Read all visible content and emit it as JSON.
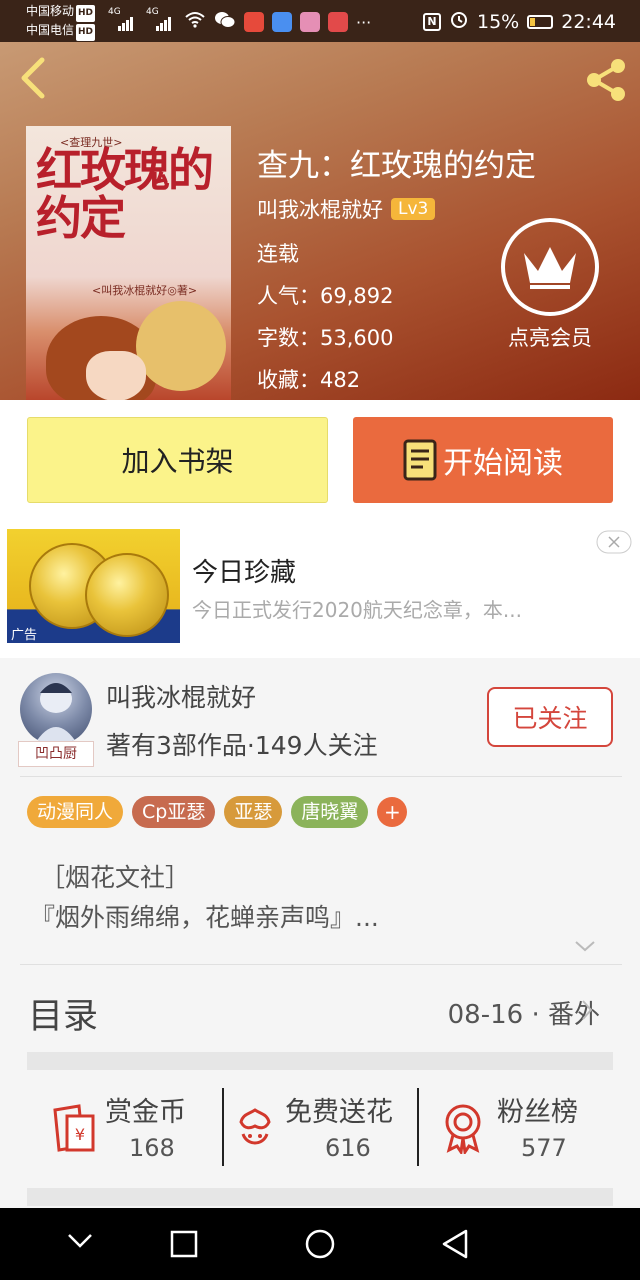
{
  "status_bar": {
    "carrier1": "中国移动",
    "carrier2": "中国电信",
    "hd": "HD",
    "net": "4G",
    "more": "···",
    "nfc": "N",
    "battery": "15%",
    "time": "22:44"
  },
  "book": {
    "cover_series": "<查理九世>",
    "cover_title": "红玫瑰的约定",
    "cover_author": "<叫我冰棍就好◎著>",
    "title": "查九：红玫瑰的约定",
    "author": "叫我冰棍就好",
    "level": "Lv3",
    "status": "连载",
    "popularity": "人气：69,892",
    "words": "字数：53,600",
    "favorites": "收藏：482",
    "vip_label": "点亮会员"
  },
  "actions": {
    "add_shelf": "加入书架",
    "start_read": "开始阅读"
  },
  "ad": {
    "tag": "广告",
    "title": "今日珍藏",
    "description": "今日正式发行2020航天纪念章，本..."
  },
  "author_card": {
    "name": "叫我冰棍就好",
    "badge": "凹凸厨",
    "stats": "著有3部作品·149人关注",
    "follow_label": "已关注",
    "tags": [
      {
        "label": "动漫同人",
        "color": "#f0a93a"
      },
      {
        "label": "Cp亚瑟",
        "color": "#c76b4f"
      },
      {
        "label": "亚瑟",
        "color": "#d79a3b"
      },
      {
        "label": "唐晓翼",
        "color": "#8bb35a"
      }
    ],
    "add_tag": "+",
    "intro_line1": "［烟花文社］",
    "intro_line2": "『烟外雨绵绵，花蝉亲声鸣』..."
  },
  "toc": {
    "label": "目录",
    "latest": "08-16 · 番外"
  },
  "stats": [
    {
      "label": "赏金币",
      "value": "168",
      "icon": "red-envelope-icon"
    },
    {
      "label": "免费送花",
      "value": "616",
      "icon": "flower-icon"
    },
    {
      "label": "粉丝榜",
      "value": "577",
      "icon": "medal-icon"
    }
  ],
  "colors": {
    "accent_orange": "#ea6a3e",
    "shelf_yellow": "#fbf38a",
    "follow_red": "#d4463c",
    "icon_red": "#d2382c"
  }
}
